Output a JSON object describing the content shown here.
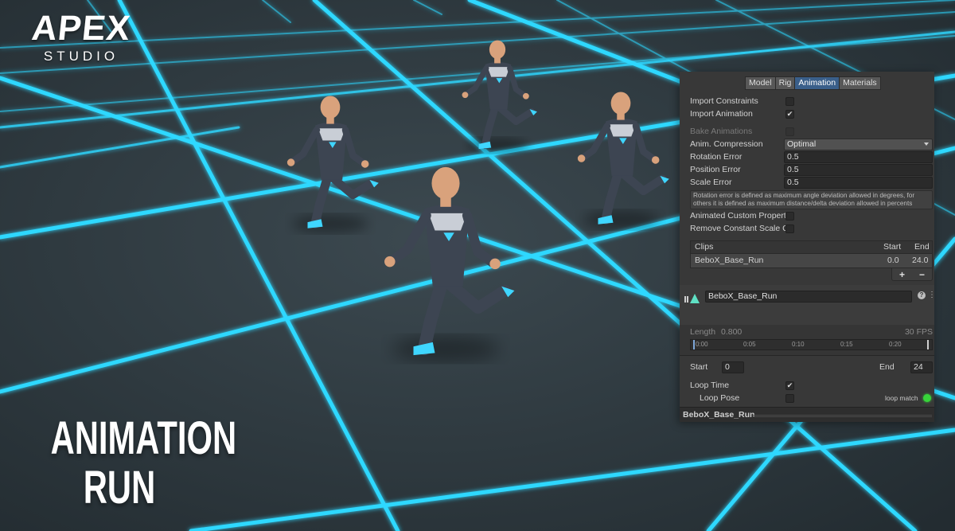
{
  "logo": {
    "main": "APEX",
    "sub": "STUDIO"
  },
  "title": {
    "line1": "ANIMATION",
    "line2": "RUN"
  },
  "inspector": {
    "tabs": [
      {
        "label": "Model",
        "active": false
      },
      {
        "label": "Rig",
        "active": false
      },
      {
        "label": "Animation",
        "active": true
      },
      {
        "label": "Materials",
        "active": false
      }
    ],
    "import_constraints": {
      "label": "Import Constraints",
      "checked": false
    },
    "import_animation": {
      "label": "Import Animation",
      "checked": true,
      "mark": "✔"
    },
    "bake_animations": {
      "label": "Bake Animations",
      "checked": false
    },
    "anim_compression": {
      "label": "Anim. Compression",
      "value": "Optimal"
    },
    "rotation_error": {
      "label": "Rotation Error",
      "value": "0.5"
    },
    "position_error": {
      "label": "Position Error",
      "value": "0.5"
    },
    "scale_error": {
      "label": "Scale Error",
      "value": "0.5"
    },
    "help_text": "Rotation error is defined as maximum angle deviation allowed in degrees, for others it is defined as maximum distance/delta deviation allowed in percents",
    "animated_custom_properties": {
      "label": "Animated Custom Properti",
      "checked": false
    },
    "remove_constant_scale": {
      "label": "Remove Constant Scale C",
      "checked": false
    },
    "clips": {
      "header": {
        "name": "Clips",
        "start": "Start",
        "end": "End"
      },
      "rows": [
        {
          "name": "BeboX_Base_Run",
          "start": "0.0",
          "end": "24.0"
        }
      ],
      "add": "+",
      "remove": "−"
    },
    "clip": {
      "name": "BeboX_Base_Run",
      "help": "?",
      "menu": "⋮",
      "length_label": "Length",
      "length_value": "0.800",
      "fps": "30 FPS",
      "ticks": [
        "0:00",
        "0:05",
        "0:10",
        "0:15",
        "0:20"
      ],
      "start_label": "Start",
      "start_value": "0",
      "end_label": "End",
      "end_value": "24",
      "loop_time": {
        "label": "Loop Time",
        "checked": true,
        "mark": "✔"
      },
      "loop_pose": {
        "label": "Loop Pose",
        "checked": false
      },
      "loop_match": "loop match",
      "loop_match_color": "#37d43a"
    },
    "footer_title": "BeboX_Base_Run"
  },
  "colors": {
    "grid_glow": "#2fd8ff",
    "floor": "#2f3b42",
    "panel_bg": "#383838",
    "active_tab": "#3a5f8a"
  }
}
